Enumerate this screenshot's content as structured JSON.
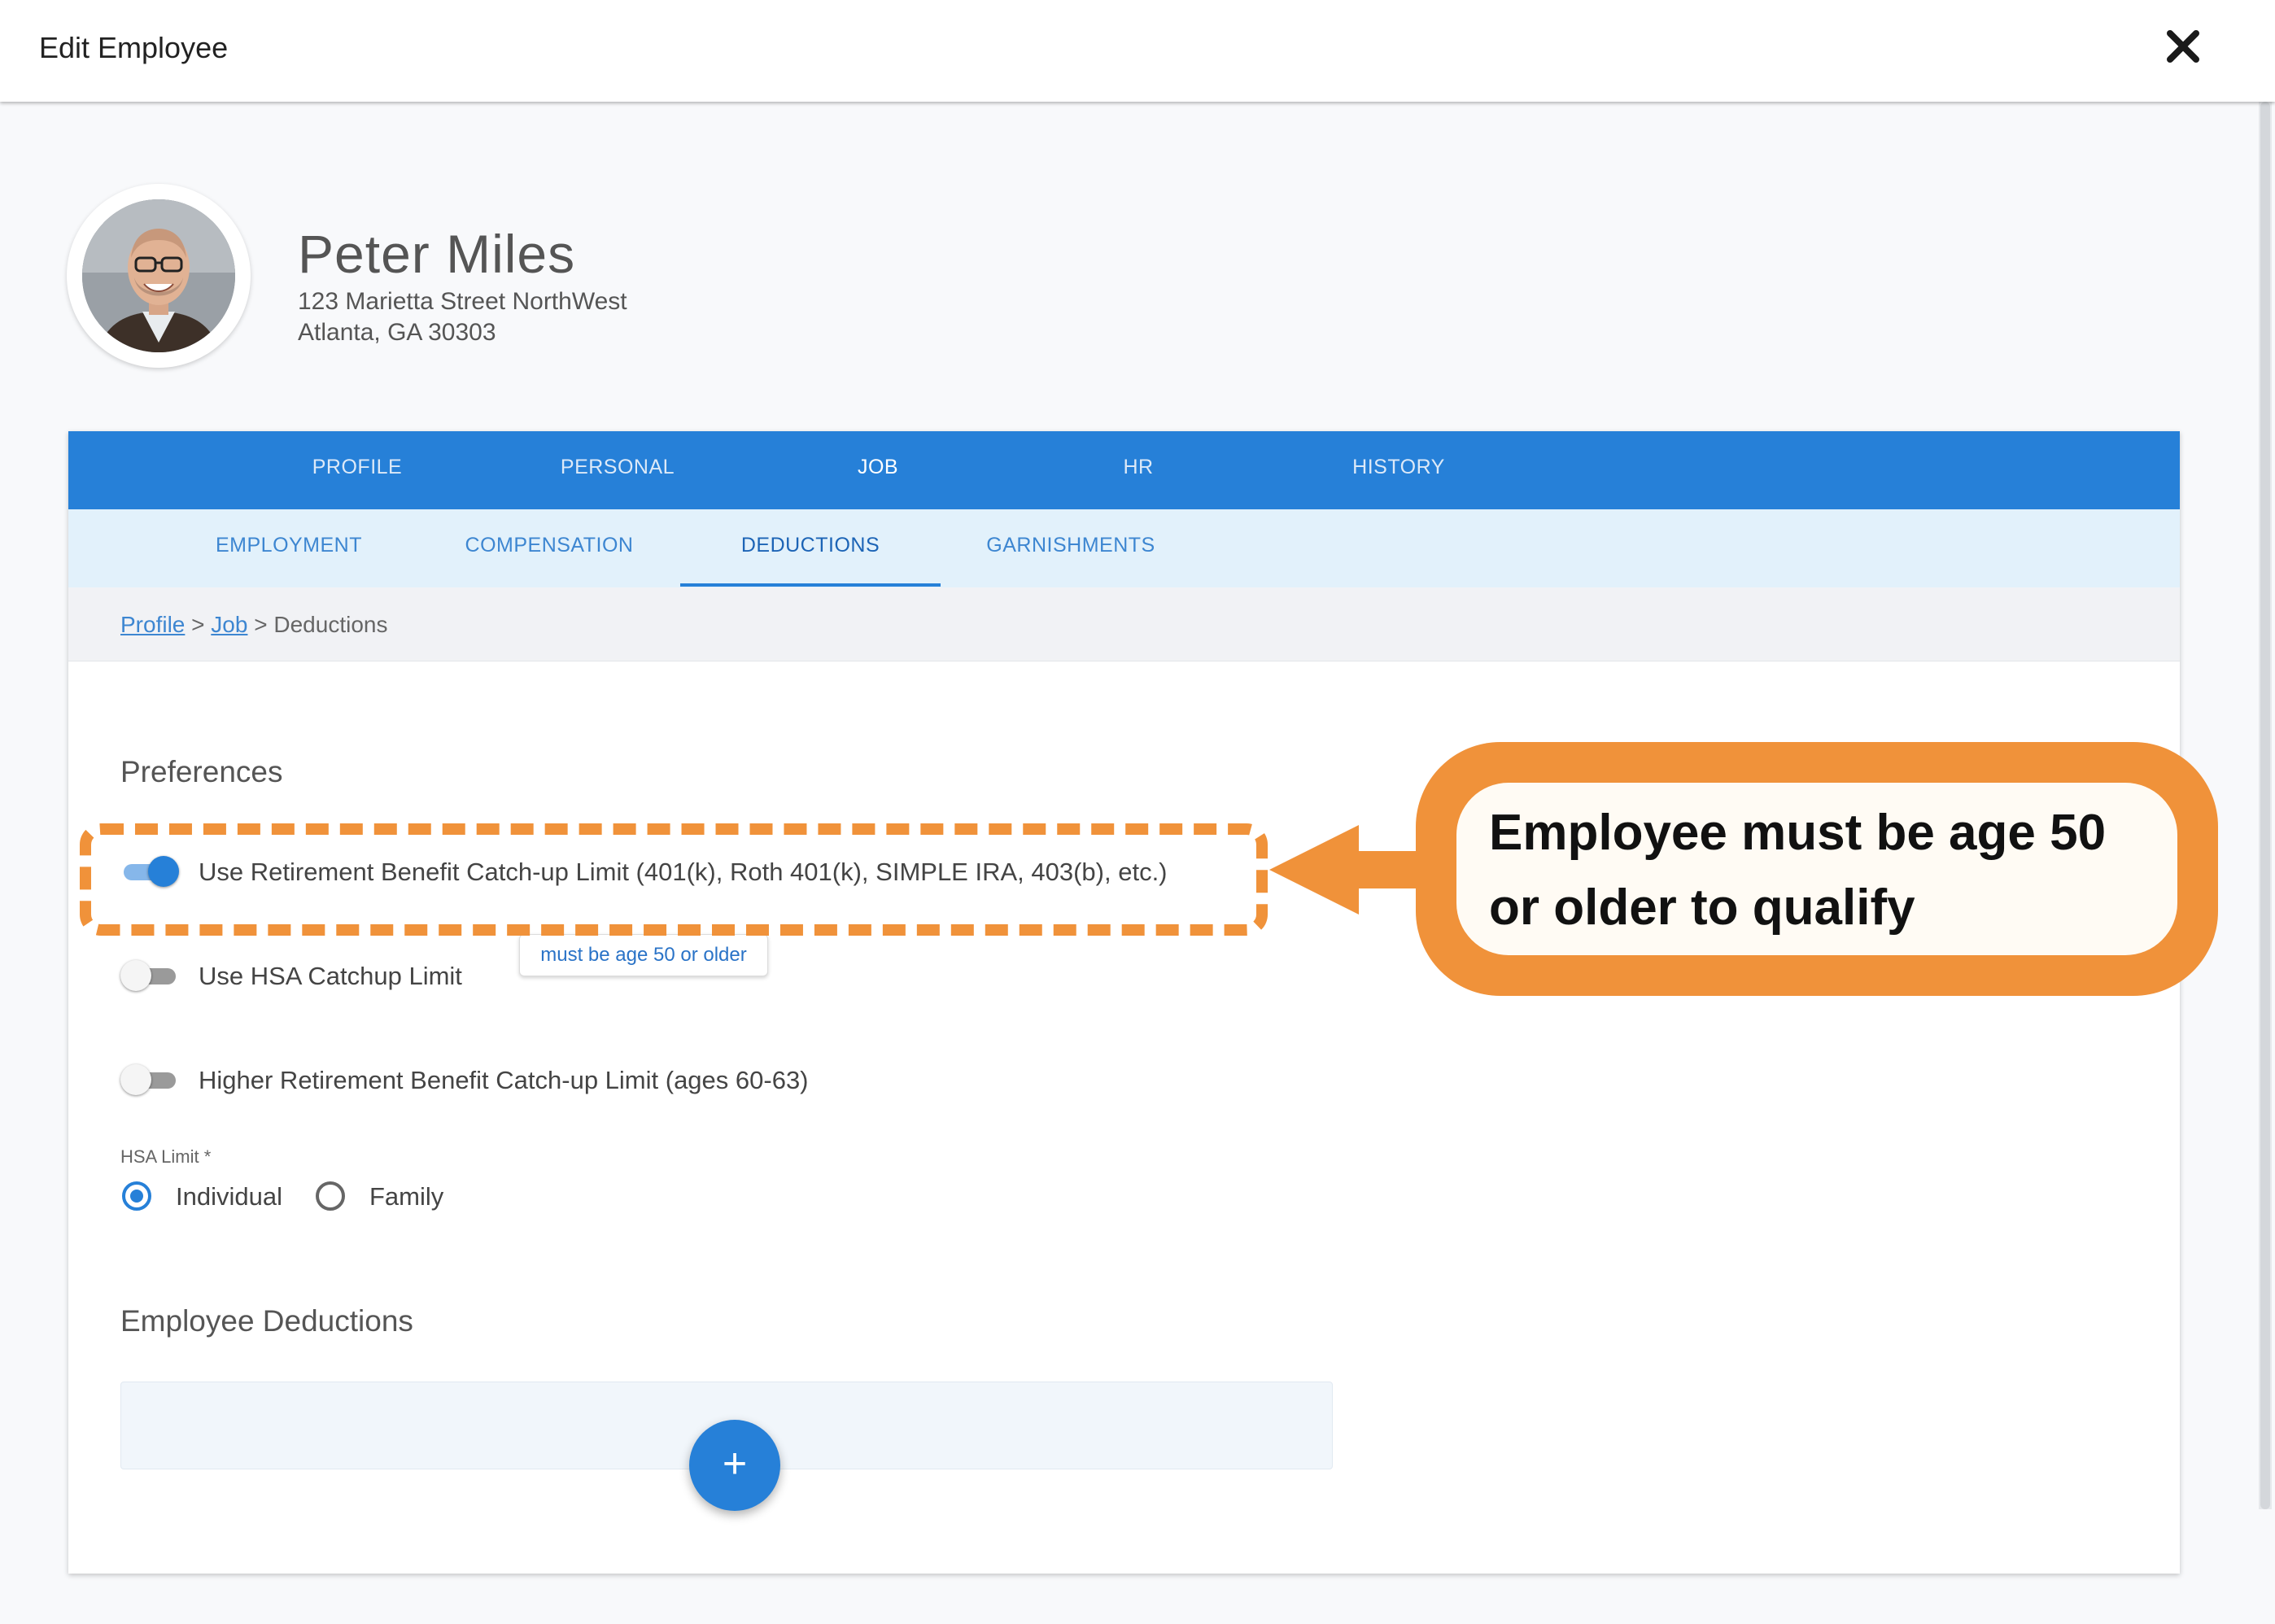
{
  "dialog": {
    "title": "Edit Employee",
    "close_icon": "close-icon"
  },
  "employee": {
    "name": "Peter Miles",
    "address_line1": "123 Marietta Street NorthWest",
    "address_line2": "Atlanta, GA 30303"
  },
  "tabs": {
    "primary": [
      {
        "label": "PROFILE",
        "active": false
      },
      {
        "label": "PERSONAL",
        "active": false
      },
      {
        "label": "JOB",
        "active": true
      },
      {
        "label": "HR",
        "active": false
      },
      {
        "label": "HISTORY",
        "active": false
      }
    ],
    "secondary": [
      {
        "label": "EMPLOYMENT",
        "active": false
      },
      {
        "label": "COMPENSATION",
        "active": false
      },
      {
        "label": "DEDUCTIONS",
        "active": true
      },
      {
        "label": "GARNISHMENTS",
        "active": false
      }
    ]
  },
  "breadcrumb": {
    "link1": "Profile",
    "sep1": ">",
    "link2": "Job",
    "sep2": ">",
    "current": "Deductions"
  },
  "preferences": {
    "title": "Preferences",
    "items": [
      {
        "label": "Use Retirement Benefit Catch-up Limit (401(k), Roth 401(k), SIMPLE IRA, 403(b), etc.)",
        "on": true
      },
      {
        "label": "Use HSA Catchup Limit",
        "on": false
      },
      {
        "label": "Higher Retirement Benefit Catch-up Limit (ages 60-63)",
        "on": false
      }
    ],
    "tooltip": "must be age 50 or older",
    "hsa_limit": {
      "label": "HSA Limit *",
      "options": [
        {
          "label": "Individual",
          "selected": true
        },
        {
          "label": "Family",
          "selected": false
        }
      ]
    }
  },
  "deductions": {
    "title": "Employee Deductions",
    "add_button": "+"
  },
  "callout": {
    "text": "Employee must be age 50 or older to qualify"
  },
  "colors": {
    "primary": "#2680d8",
    "accent": "#f0923a",
    "tab_bar_secondary": "#e2f1fb"
  }
}
